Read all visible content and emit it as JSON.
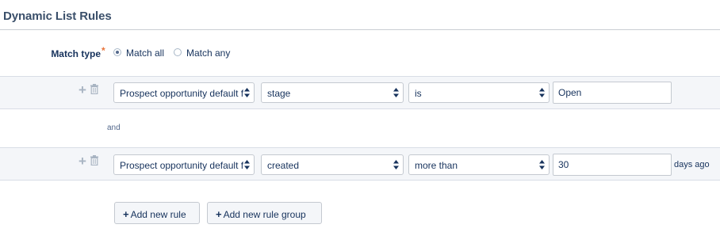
{
  "section": {
    "title": "Dynamic List Rules"
  },
  "match_type": {
    "label": "Match type",
    "required_marker": "*",
    "options": [
      "Match all",
      "Match any"
    ],
    "selected": "Match all"
  },
  "rules": [
    {
      "field": "Prospect opportunity default f",
      "attribute": "stage",
      "operator": "is",
      "value": "Open",
      "suffix": ""
    },
    {
      "field": "Prospect opportunity default f",
      "attribute": "created",
      "operator": "more than",
      "value": "30",
      "suffix": "days ago"
    }
  ],
  "connector": "and",
  "buttons": {
    "add_rule": "Add new rule",
    "add_group": "Add new rule group"
  },
  "icons": {
    "add": "plus-icon",
    "delete": "trash-icon",
    "select": "updown-arrows-icon"
  },
  "colors": {
    "band": "#f4f6f9",
    "text": "#16325c",
    "required": "#e8743b",
    "icon": "#a8b4c2"
  }
}
